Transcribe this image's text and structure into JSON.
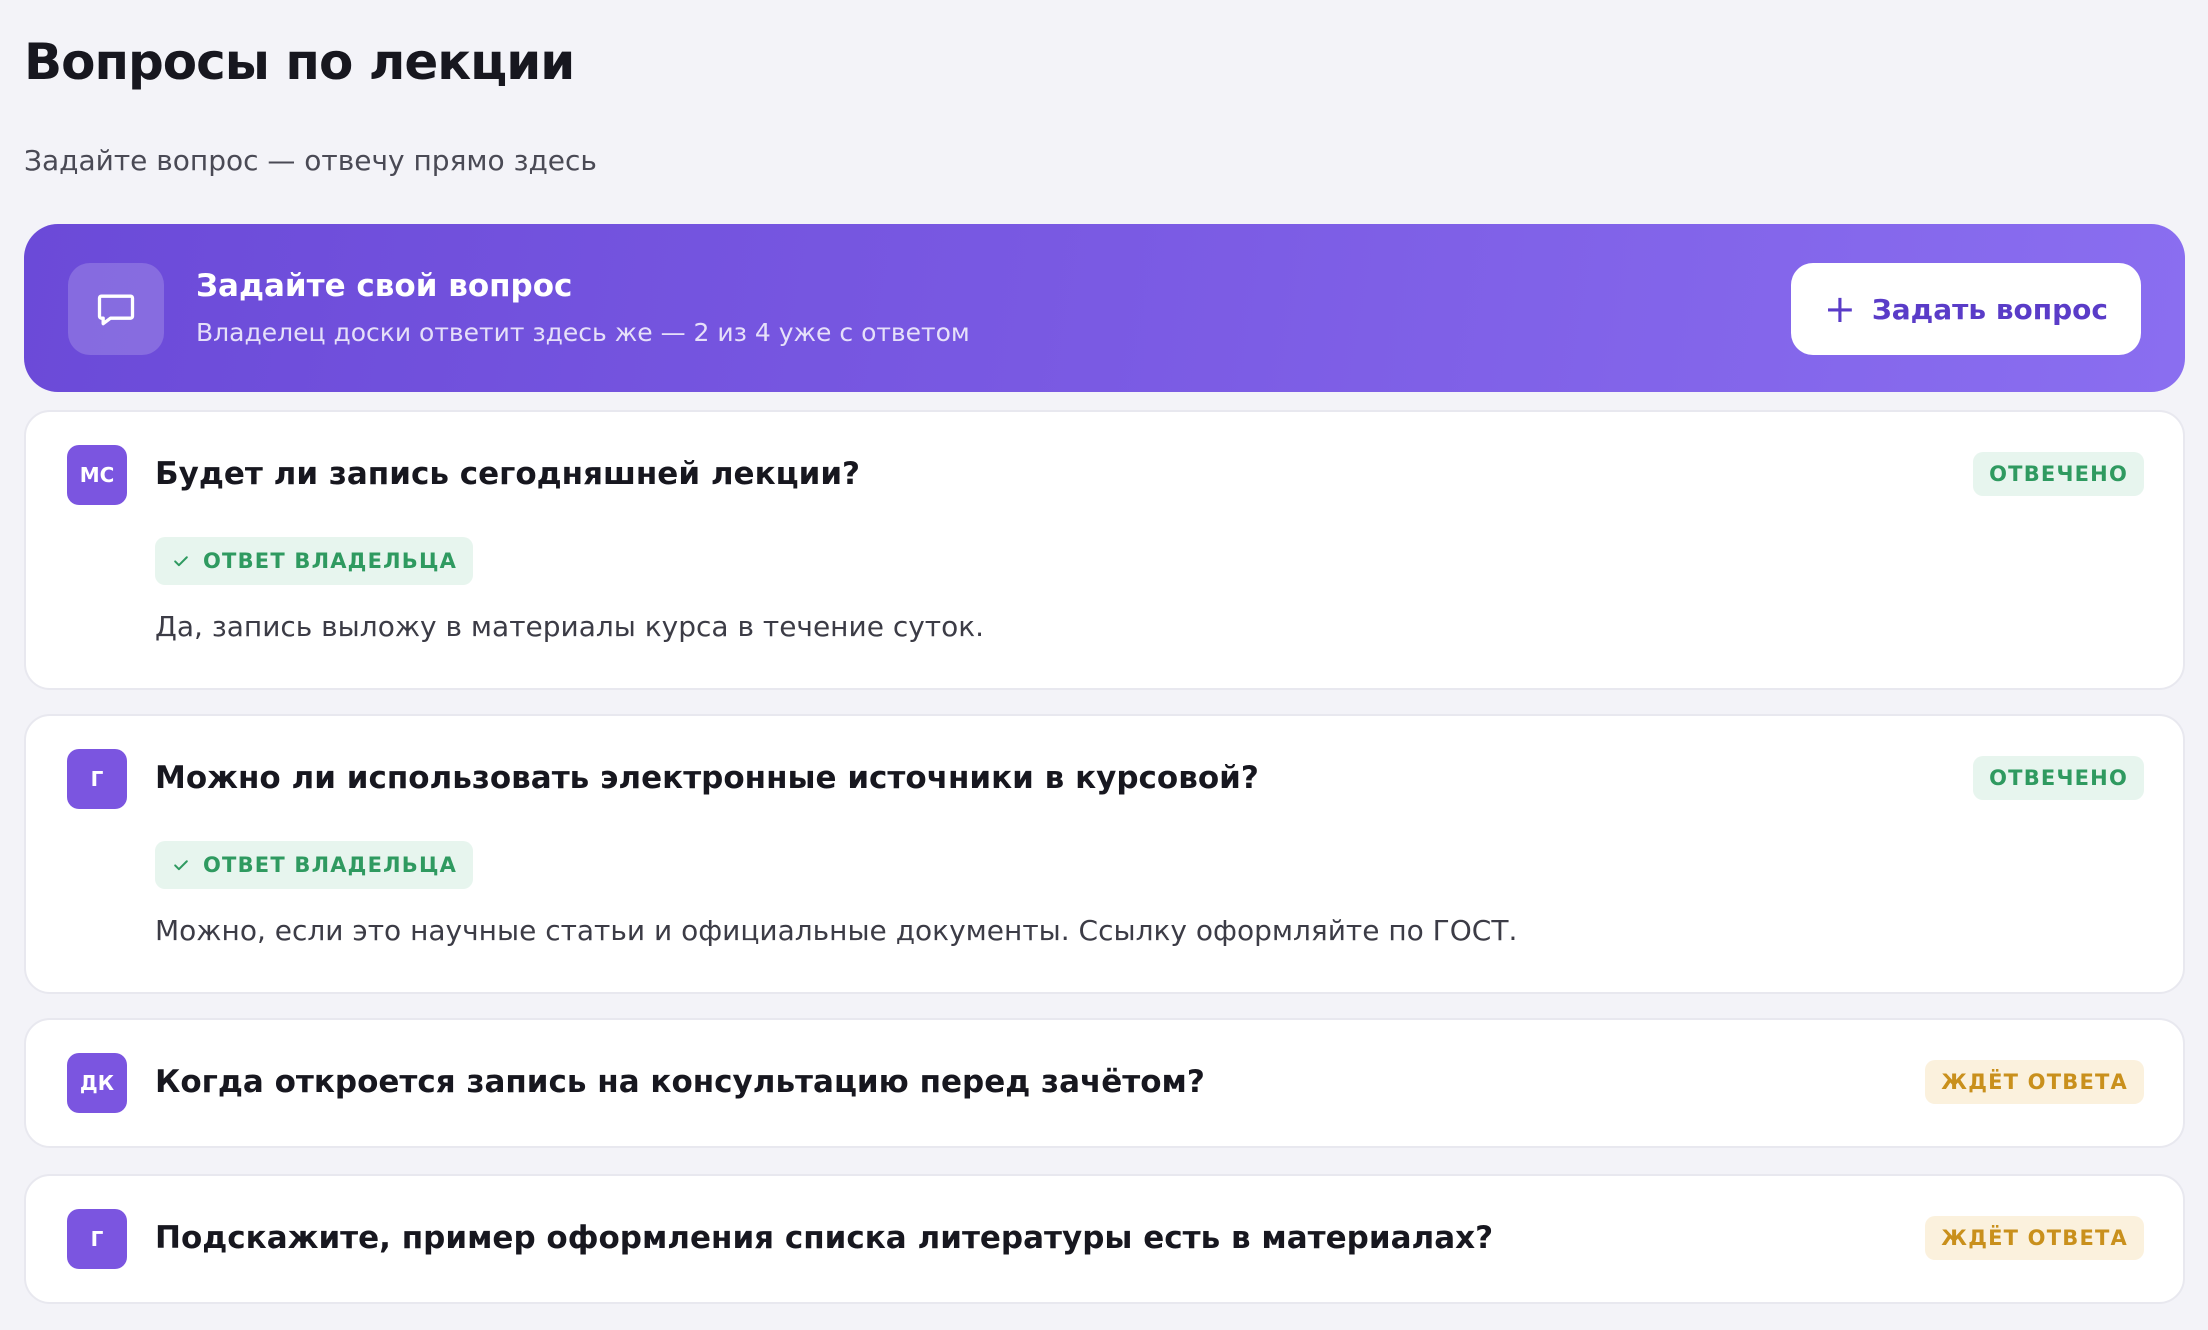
{
  "page": {
    "title": "Вопросы по лекции",
    "subtitle": "Задайте вопрос — отвечу прямо здесь"
  },
  "hero": {
    "icon": "chat-bubble-icon",
    "title": "Задайте свой вопрос",
    "subtitle": "Владелец доски ответит здесь же — 2 из 4 уже с ответом",
    "button_label": "Задать вопрос",
    "button_icon": "plus-icon"
  },
  "questions": [
    {
      "avatar": "МС",
      "title": "Будет ли запись сегодняшней лекции?",
      "status": "ОТВЕЧЕНО",
      "owner_label": "ОТВЕТ ВЛАДЕЛЬЦА",
      "answer": "Да, запись выложу в материалы курса в течение суток."
    },
    {
      "avatar": "Г",
      "title": "Можно ли использовать электронные источники в курсовой?",
      "status": "ОТВЕЧЕНО",
      "owner_label": "ОТВЕТ ВЛАДЕЛЬЦА",
      "answer": "Можно, если это научные статьи и официальные документы. Ссылку оформляйте по ГОСТ."
    },
    {
      "avatar": "ДК",
      "title": "Когда откроется запись на консультацию перед зачётом?",
      "status": "ЖДЁТ ОТВЕТА"
    },
    {
      "avatar": "Г",
      "title": "Подскажите, пример оформления списка литературы есть в материалах?",
      "status": "ЖДЁТ ОТВЕТА"
    }
  ],
  "colors": {
    "accent": "#7b55e0",
    "answered": "#2f9a60",
    "waiting": "#c9901c"
  }
}
